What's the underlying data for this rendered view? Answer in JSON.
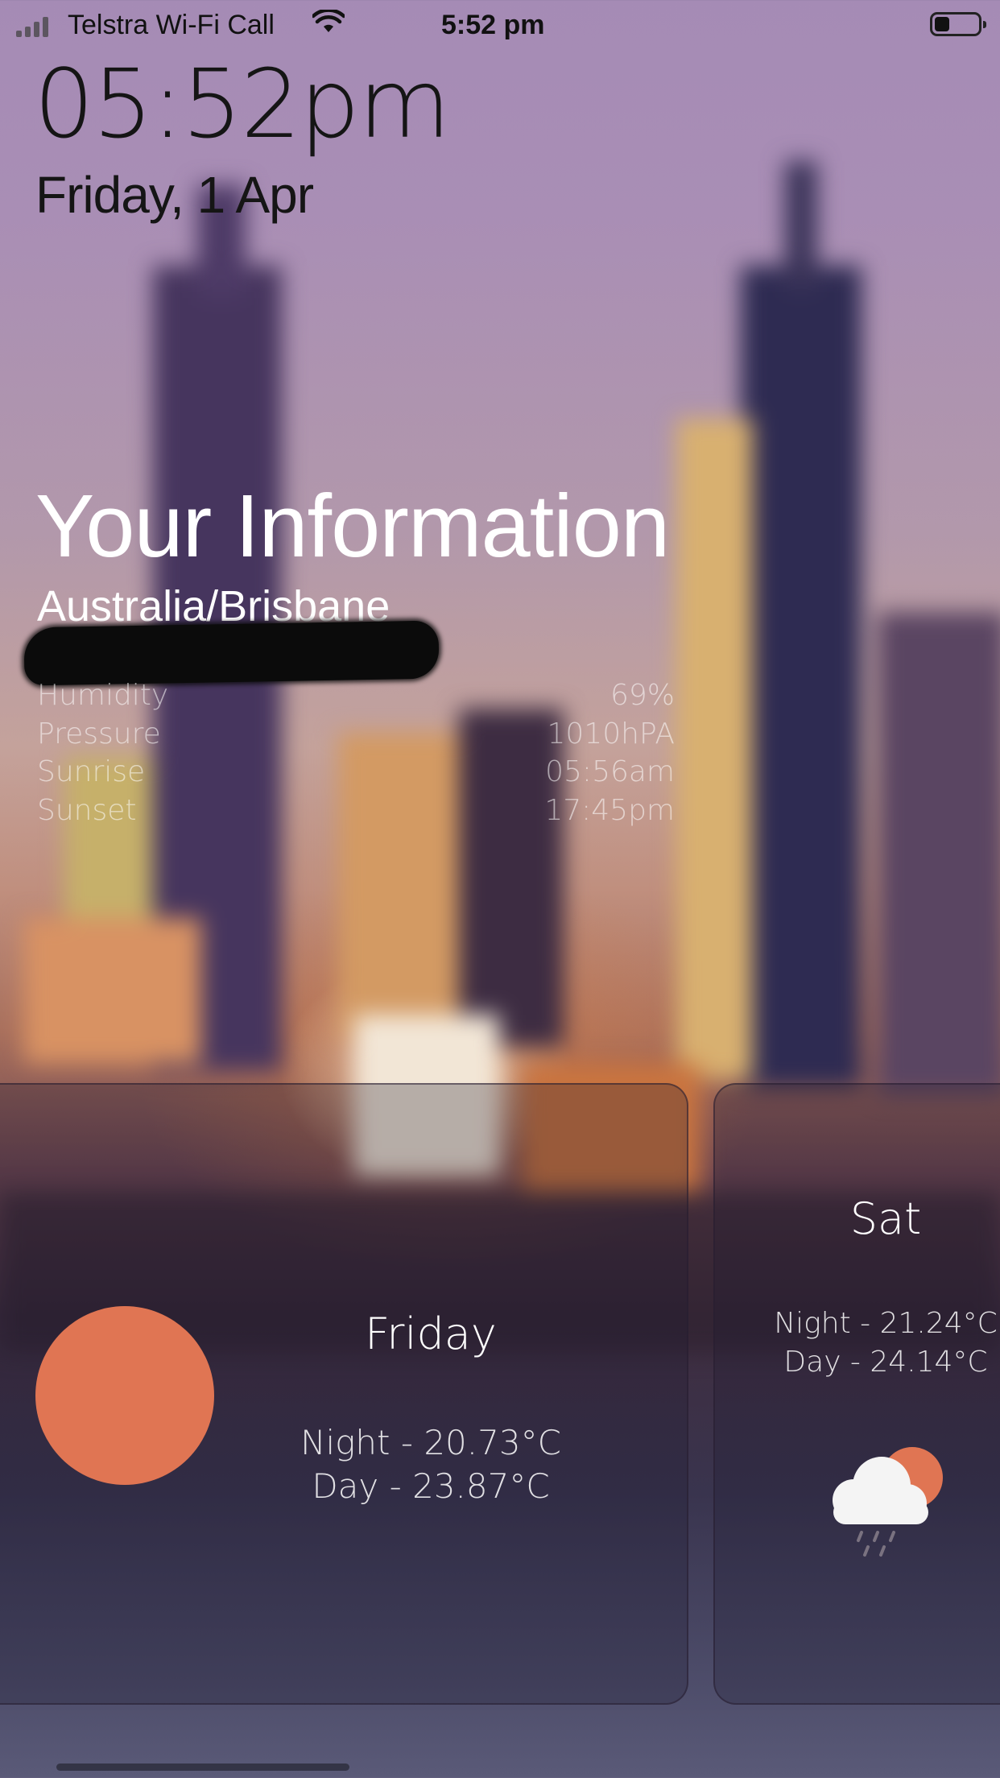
{
  "status_bar": {
    "carrier": "Telstra Wi-Fi Call",
    "time": "5:52 pm",
    "battery_level": 0.35,
    "signal_icon": "signal-bars-icon",
    "wifi_icon": "wifi-icon"
  },
  "lock_screen": {
    "clock": "05:52pm",
    "date": "Friday, 1 Apr"
  },
  "info": {
    "title": "Your Information",
    "location": "Australia/Brisbane",
    "stats": [
      {
        "label": "Humidity",
        "value": "69%"
      },
      {
        "label": "Pressure",
        "value": "1010hPA"
      },
      {
        "label": "Sunrise",
        "value": "05:56am"
      },
      {
        "label": "Sunset",
        "value": "17:45pm"
      }
    ]
  },
  "forecast": [
    {
      "day": "Friday",
      "night": "Night - 20.73°C",
      "daytime": "Day - 23.87°C",
      "icon": "sun-icon",
      "icon_color": "#e07553"
    },
    {
      "day": "Sat",
      "night": "Night - 21.24°C",
      "daytime": "Day - 24.14°C",
      "icon": "cloud-rain-sun-icon",
      "icon_color": "#e07553"
    }
  ]
}
